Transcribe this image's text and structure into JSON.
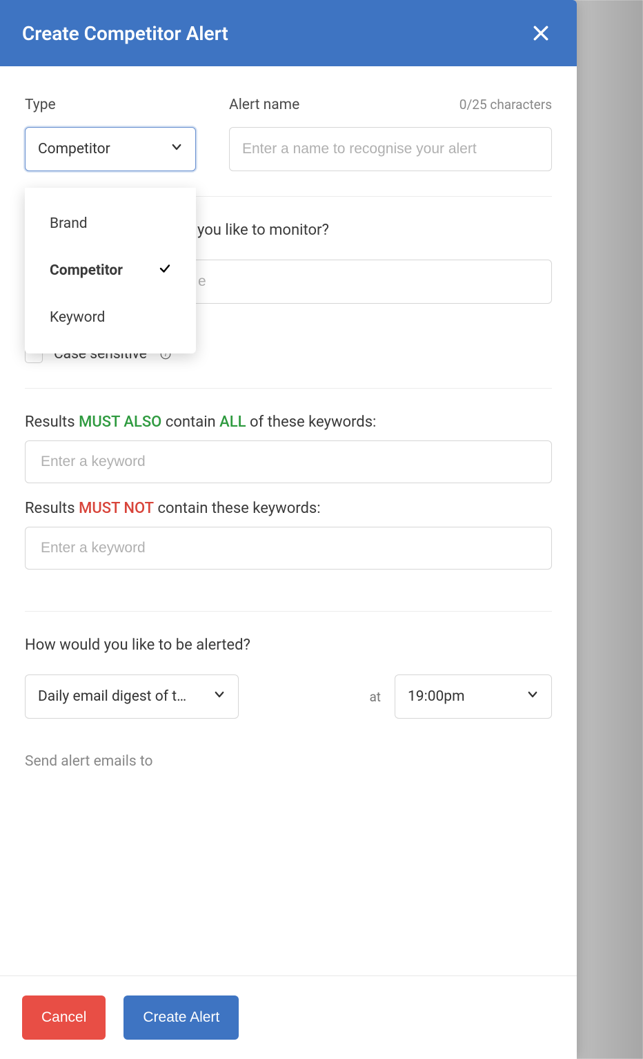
{
  "header": {
    "title": "Create Competitor Alert"
  },
  "type": {
    "label": "Type",
    "selected": "Competitor",
    "options": [
      "Brand",
      "Competitor",
      "Keyword"
    ]
  },
  "alertName": {
    "label": "Alert name",
    "counter": "0/25 characters",
    "placeholder": "Enter a name to recognise your alert",
    "value": ""
  },
  "monitor": {
    "question_prefix": "you like to monitor?",
    "placeholder_suffix": "e",
    "value": ""
  },
  "caseSensitive": {
    "label": "Case sensitive",
    "checked": false
  },
  "mustAlso": {
    "prefix": "Results ",
    "mustAlso": "MUST ALSO",
    "middle": " contain ",
    "all": "ALL",
    "suffix": " of these keywords:",
    "placeholder": "Enter a keyword"
  },
  "mustNot": {
    "prefix": "Results ",
    "mustNot": "MUST NOT",
    "suffix": " contain these keywords:",
    "placeholder": "Enter a keyword"
  },
  "alertMethod": {
    "question": "How would you like to be alerted?",
    "frequency": "Daily email digest of t…",
    "atLabel": "at",
    "time": "19:00pm"
  },
  "sendTo": {
    "label": "Send alert emails to"
  },
  "footer": {
    "cancel": "Cancel",
    "create": "Create Alert"
  }
}
